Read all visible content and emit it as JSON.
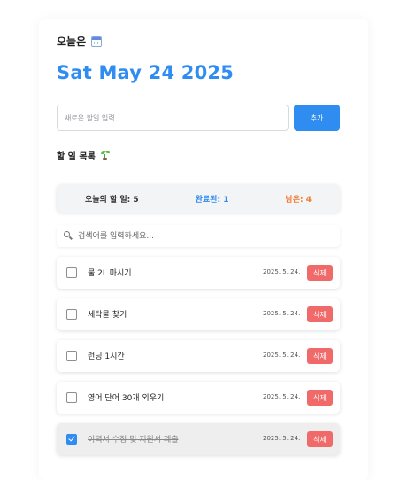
{
  "header": {
    "today_label": "오늘은",
    "today_icon": "calendar-icon",
    "date": "Sat May 24 2025"
  },
  "add_form": {
    "placeholder": "새로운 할일 입력...",
    "value": "",
    "button_label": "추가"
  },
  "list_section": {
    "title": "할 일 목록",
    "title_icon": "sprout-icon"
  },
  "stats": {
    "total_label": "오늘의 할 일: 5",
    "done_label": "완료된: 1",
    "remaining_label": "남은: 4"
  },
  "search": {
    "placeholder": "검색어를 입력하세요...",
    "value": ""
  },
  "todos": [
    {
      "text": "물 2L 마시기",
      "date": "2025. 5. 24.",
      "checked": false,
      "delete_label": "삭제"
    },
    {
      "text": "세탁물 찾기",
      "date": "2025. 5. 24.",
      "checked": false,
      "delete_label": "삭제"
    },
    {
      "text": "런닝 1시간",
      "date": "2025. 5. 24.",
      "checked": false,
      "delete_label": "삭제"
    },
    {
      "text": "영어 단어 30개 외우기",
      "date": "2025. 5. 24.",
      "checked": false,
      "delete_label": "삭제"
    },
    {
      "text": "이력서 수정 및 지원서 제출",
      "date": "2025. 5. 24.",
      "checked": true,
      "delete_label": "삭제"
    }
  ],
  "colors": {
    "accent": "#2f8cf0",
    "remaining": "#f07b2f",
    "delete": "#f06a6a"
  }
}
